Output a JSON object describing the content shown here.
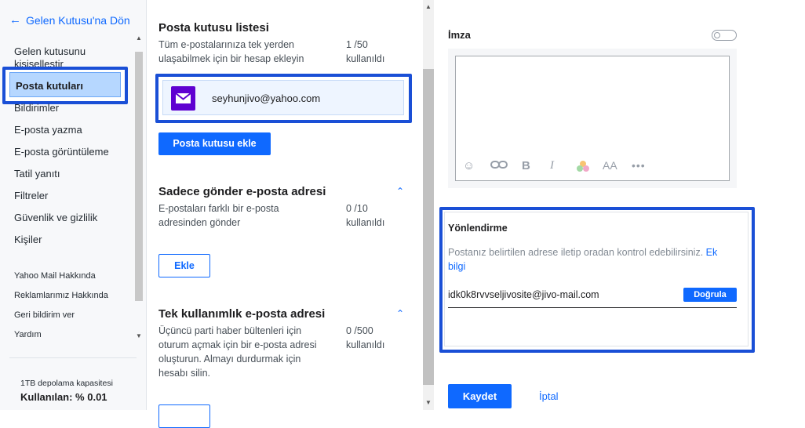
{
  "nav": {
    "back_label": "Gelen Kutusu'na Dön",
    "items": [
      "Gelen kutusunu kişiselleştir",
      "Posta kutuları",
      "Bildirimler",
      "E-posta yazma",
      "E-posta görüntüleme",
      "Tatil yanıtı",
      "Filtreler",
      "Güvenlik ve gizlilik",
      "Kişiler"
    ],
    "selected": "Posta kutuları",
    "footer_links": [
      "Yahoo Mail Hakkında",
      "Reklamlarımız Hakkında",
      "Geri bildirim ver",
      "Yardım"
    ],
    "storage": {
      "capacity": "1TB depolama kapasitesi",
      "usage": "Kullanılan: % 0.01"
    }
  },
  "mailbox_list": {
    "title": "Posta kutusu listesi",
    "description": "Tüm e-postalarınıza tek yerden ulaşabilmek için bir hesap ekleyin",
    "count": "1 /50",
    "count_label": "kullanıldı",
    "accounts": [
      "seyhunjivo@yahoo.com"
    ],
    "add_button": "Posta kutusu ekle"
  },
  "send_only": {
    "title": "Sadece gönder e-posta adresi",
    "description": "E-postaları farklı bir e-posta adresinden gönder",
    "count": "0 /10",
    "count_label": "kullanıldı",
    "add_button": "Ekle"
  },
  "disposable": {
    "title": "Tek kullanımlık e-posta adresi",
    "description": "Üçüncü parti haber bültenleri için oturum açmak için bir e-posta adresi oluşturun. Almayı durdurmak için hesabı silin.",
    "count": "0 /500",
    "count_label": "kullanıldı"
  },
  "signature": {
    "title": "İmza",
    "enabled": false
  },
  "forwarding": {
    "title": "Yönlendirme",
    "description": "Postanız belirtilen adrese iletip oradan kontrol edebilirsiniz.",
    "more_info": "Ek bilgi",
    "email_value": "idk0k8rvvseljivosite@jivo-mail.com",
    "verify_button": "Doğrula"
  },
  "actions": {
    "save": "Kaydet",
    "cancel": "İptal"
  },
  "colors": {
    "accent": "#0f69ff",
    "highlight": "#1a4fd6",
    "yahoo": "#5f01d1"
  }
}
